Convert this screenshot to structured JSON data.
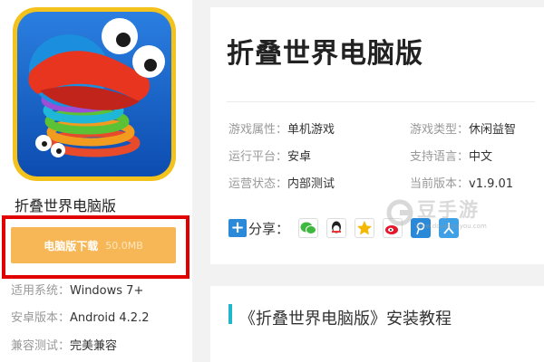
{
  "app": {
    "name": "折叠世界电脑版",
    "title": "折叠世界电脑版"
  },
  "download": {
    "label": "电脑版下载",
    "size": "50.0MB"
  },
  "sidebar_info": [
    {
      "key": "适用系统：",
      "value": "Windows 7+"
    },
    {
      "key": "安卓版本：",
      "value": "Android 4.2.2"
    },
    {
      "key": "兼容测试：",
      "value": "完美兼容"
    }
  ],
  "properties": [
    {
      "key": "游戏属性：",
      "value": "单机游戏"
    },
    {
      "key": "游戏类型：",
      "value": "休闲益智"
    },
    {
      "key": "运行平台：",
      "value": "安卓"
    },
    {
      "key": "支持语言：",
      "value": "中文"
    },
    {
      "key": "运营状态：",
      "value": "内部测试"
    },
    {
      "key": "当前版本：",
      "value": "v1.9.01"
    }
  ],
  "share": {
    "plus": "+",
    "label": "分享：",
    "icons": [
      "wechat-icon",
      "qq-icon",
      "qzone-icon",
      "weibo-icon",
      "tencent-weibo-icon",
      "renren-icon"
    ]
  },
  "watermark": {
    "text": "豆手游",
    "url": "www.doushouyou.com"
  },
  "tutorial": {
    "title": "《折叠世界电脑版》安装教程"
  },
  "colors": {
    "download_button": "#f7b756",
    "highlight_border": "#e10000",
    "accent_bar": "#20b8c8",
    "share_plus": "#2a8ad9"
  }
}
